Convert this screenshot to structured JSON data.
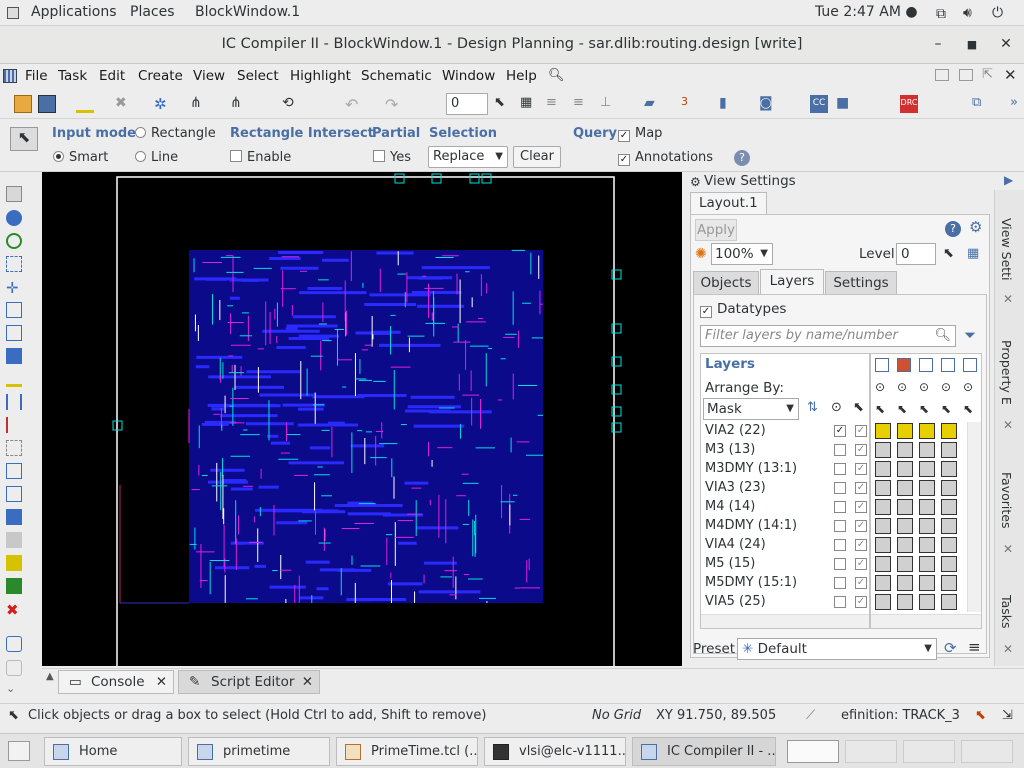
{
  "gnome": {
    "applications": "Applications",
    "places": "Places",
    "window": "BlockWindow.1",
    "time": "Tue  2:47 AM ●"
  },
  "window": {
    "title": "IC Compiler II - BlockWindow.1 - Design Planning - sar.dlib:routing.design [write]"
  },
  "menu": [
    "File",
    "Task",
    "Edit",
    "Create",
    "View",
    "Select",
    "Highlight",
    "Schematic",
    "Window",
    "Help"
  ],
  "toolbar": {
    "zero": "0"
  },
  "options": {
    "input_mode": "Input mode",
    "rectangle": "Rectangle",
    "smart": "Smart",
    "line": "Line",
    "rect_intersect": "Rectangle Intersect",
    "enable": "Enable",
    "partial": "Partial",
    "yes": "Yes",
    "selection": "Selection",
    "replace": "Replace",
    "clear": "Clear",
    "query": "Query",
    "map": "Map",
    "annotations": "Annotations"
  },
  "view_settings": {
    "header": "View Settings",
    "tab": "Layout.1",
    "apply": "Apply",
    "zoom": "100%",
    "level_label": "Level",
    "level": "0",
    "tabs": [
      "Objects",
      "Layers",
      "Settings"
    ],
    "datatypes": "Datatypes",
    "filter_placeholder": "Filter layers by name/number",
    "layers_title": "Layers",
    "arrange_by": "Arrange By:",
    "arrange_value": "Mask",
    "layers": [
      {
        "name": "VIA2 (22)",
        "vis": true,
        "sel": true
      },
      {
        "name": "M3 (13)",
        "vis": false,
        "sel": true
      },
      {
        "name": "M3DMY (13:1)",
        "vis": false,
        "sel": true
      },
      {
        "name": "VIA3 (23)",
        "vis": false,
        "sel": true
      },
      {
        "name": "M4 (14)",
        "vis": false,
        "sel": true
      },
      {
        "name": "M4DMY (14:1)",
        "vis": false,
        "sel": true
      },
      {
        "name": "VIA4 (24)",
        "vis": false,
        "sel": true
      },
      {
        "name": "M5 (15)",
        "vis": false,
        "sel": true
      },
      {
        "name": "M5DMY (15:1)",
        "vis": false,
        "sel": true
      },
      {
        "name": "VIA5 (25)",
        "vis": false,
        "sel": true
      }
    ],
    "preset_label": "Preset",
    "preset_value": "Default"
  },
  "side_tabs": [
    "View Setti",
    "Property E",
    "Favorites",
    "Tasks"
  ],
  "console_tabs": [
    "Console",
    "Script Editor"
  ],
  "status": {
    "hint": "Click objects or drag a box to select (Hold Ctrl to add, Shift to remove)",
    "grid": "No Grid",
    "xy": "XY 91.750, 89.505",
    "track": "efinition: TRACK_3"
  },
  "taskbar": [
    "Home",
    "primetime",
    "PrimeTime.tcl (...",
    "vlsi@elc-v1111...",
    "IC Compiler II - ..."
  ],
  "colors": {
    "accent": "#4a6fa5",
    "canvas": "#000000",
    "layout_blue": "#1a1aff",
    "layout_magenta": "#e020e0",
    "layout_cyan": "#00e0e0"
  }
}
